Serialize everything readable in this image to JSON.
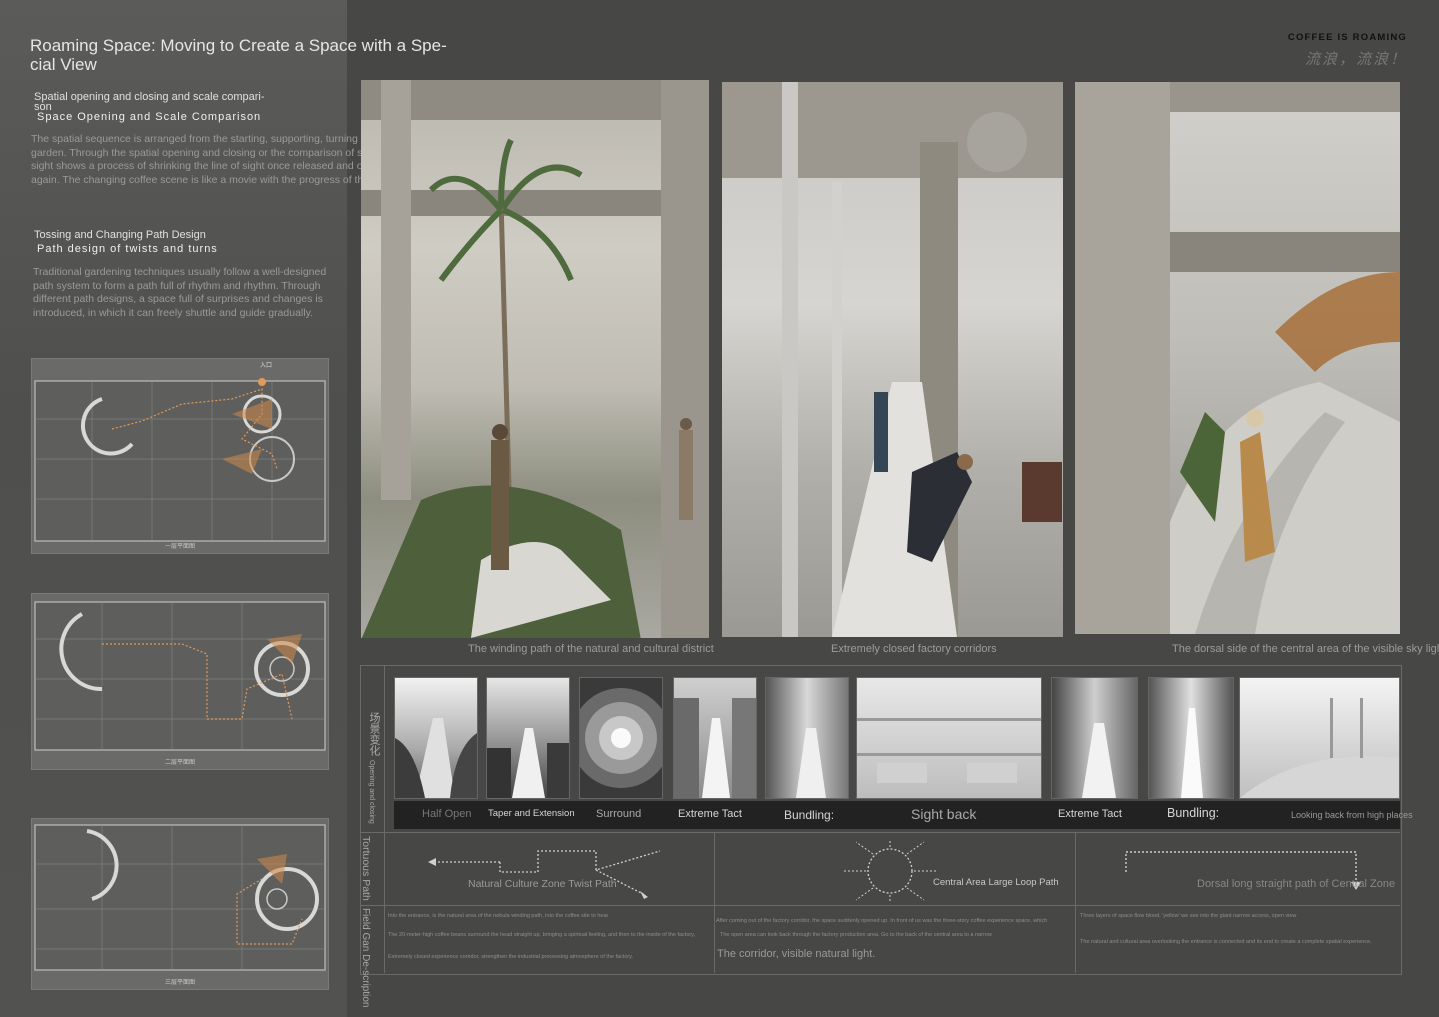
{
  "header": {
    "title": "Roaming Space: Moving to Create a Space with a Spe-cial View",
    "brand": "COFFEE IS ROAMING",
    "brand_cn": "流浪，流浪！"
  },
  "section1": {
    "subtitle_small": "Spatial opening and closing and scale compari-son",
    "subtitle": "Space Opening and Scale Comparison",
    "body": "The spatial sequence is arranged from the starting, supporting, turning to the end of the garden. Through the spatial opening and closing or the comparison of scale size, the line of sight shows a process of shrinking the line of sight once released and opened again and again. The changing coffee scene is like a movie with the progress of the story."
  },
  "section2": {
    "subtitle_small": "Tossing and Changing Path Design",
    "subtitle": "Path design of twists and turns",
    "body": "Traditional gardening techniques usually follow a well-designed path system to form a path full of rhythm and rhythm. Through different path designs, a space full of surprises and changes is introduced, in which it can freely shuttle and guide gradually."
  },
  "plans": [
    {
      "label": "一层平面图",
      "entrance": "入口"
    },
    {
      "label": "二层平面图"
    },
    {
      "label": "三层平面图"
    }
  ],
  "renders": [
    {
      "caption": "The winding path of the natural and cultural district"
    },
    {
      "caption": "Extremely closed factory corridors"
    },
    {
      "caption": "The dorsal side of the central area of the visible sky light"
    }
  ],
  "sequence": {
    "row_label_cn": "场景变化",
    "row_label_en": "Opening and closing",
    "tags": [
      "Half Open",
      "Taper and Extension",
      "Surround",
      "Extreme Tact",
      "Bundling:",
      "Sight back",
      "Extreme Tact",
      "Bundling:",
      "Looking back from high places"
    ]
  },
  "paths": {
    "row_label": "Tortuous Path",
    "items": [
      {
        "label": "Natural Culture Zone Twist Path"
      },
      {
        "label": "Central Area Large Loop Path"
      },
      {
        "label": "Dorsal long straight path of Central Zone"
      }
    ]
  },
  "descriptions": {
    "row_label": "Field Gan De-scription",
    "col1": [
      "Into the entrance, is the natural area of the nebula winding path, into the coffee site to hear",
      "The 20-meter-high coffee beans surround the head straight up, bringing a spiritual feeling, and then to the inside of the factory,",
      "Extremely closed experience corridor, strengthen the industrial processing atmosphere of the factory."
    ],
    "col2": [
      "After coming out of the factory corridor, the space suddenly opened up. In front of us was the three-story coffee experience space, which",
      "The open area can look back through the factory production area. Go to the back of the central area to a narrow",
      "The corridor, visible natural light."
    ],
    "col3": [
      "Three layers of space flow blood, 'yellow' we see into the giant narrow access, open view",
      "The natural and cultural area overlooking the entrance is connected and its end to create a complete spatial experience."
    ]
  }
}
